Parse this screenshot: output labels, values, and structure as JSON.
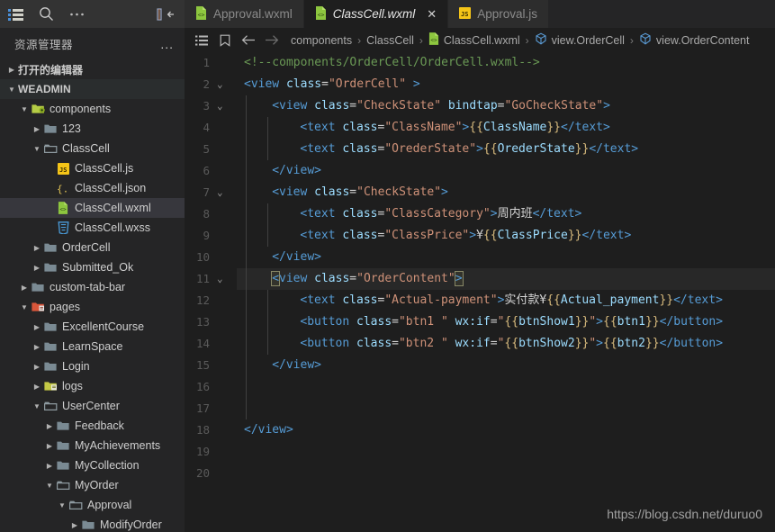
{
  "activity_bar": {
    "icons": [
      {
        "name": "explorer-list-icon",
        "label": "list"
      },
      {
        "name": "search-icon",
        "label": "search"
      },
      {
        "name": "more-actions-icon",
        "label": "..."
      }
    ],
    "collapse_label": "collapse-sidebar"
  },
  "sidebar": {
    "title": "资源管理器",
    "more_label": "...",
    "sections": [
      {
        "label": "打开的编辑器",
        "expanded": false
      },
      {
        "label": "WEADMIN",
        "expanded": true
      }
    ],
    "tree": [
      {
        "label": "components",
        "depth": 1,
        "icon": "folder-components",
        "open": true,
        "selected": false
      },
      {
        "label": "123",
        "depth": 2,
        "icon": "folder",
        "open": false,
        "selected": false
      },
      {
        "label": "ClassCell",
        "depth": 2,
        "icon": "folder-open",
        "open": true,
        "selected": false
      },
      {
        "label": "ClassCell.js",
        "depth": 3,
        "icon": "file-js",
        "open": null,
        "selected": false
      },
      {
        "label": "ClassCell.json",
        "depth": 3,
        "icon": "file-json",
        "open": null,
        "selected": false
      },
      {
        "label": "ClassCell.wxml",
        "depth": 3,
        "icon": "file-wxml",
        "open": null,
        "selected": true
      },
      {
        "label": "ClassCell.wxss",
        "depth": 3,
        "icon": "file-wxss",
        "open": null,
        "selected": false
      },
      {
        "label": "OrderCell",
        "depth": 2,
        "icon": "folder",
        "open": false,
        "selected": false
      },
      {
        "label": "Submitted_Ok",
        "depth": 2,
        "icon": "folder",
        "open": false,
        "selected": false
      },
      {
        "label": "custom-tab-bar",
        "depth": 1,
        "icon": "folder",
        "open": false,
        "selected": false
      },
      {
        "label": "pages",
        "depth": 1,
        "icon": "folder-pages",
        "open": true,
        "selected": false
      },
      {
        "label": "ExcellentCourse",
        "depth": 2,
        "icon": "folder",
        "open": false,
        "selected": false
      },
      {
        "label": "LearnSpace",
        "depth": 2,
        "icon": "folder",
        "open": false,
        "selected": false
      },
      {
        "label": "Login",
        "depth": 2,
        "icon": "folder",
        "open": false,
        "selected": false
      },
      {
        "label": "logs",
        "depth": 2,
        "icon": "folder-logs",
        "open": false,
        "selected": false
      },
      {
        "label": "UserCenter",
        "depth": 2,
        "icon": "folder-open",
        "open": true,
        "selected": false
      },
      {
        "label": "Feedback",
        "depth": 3,
        "icon": "folder",
        "open": false,
        "selected": false
      },
      {
        "label": "MyAchievements",
        "depth": 3,
        "icon": "folder",
        "open": false,
        "selected": false
      },
      {
        "label": "MyCollection",
        "depth": 3,
        "icon": "folder",
        "open": false,
        "selected": false
      },
      {
        "label": "MyOrder",
        "depth": 3,
        "icon": "folder-open",
        "open": true,
        "selected": false
      },
      {
        "label": "Approval",
        "depth": 4,
        "icon": "folder-open",
        "open": true,
        "selected": false
      },
      {
        "label": "ModifyOrder",
        "depth": 5,
        "icon": "folder",
        "open": false,
        "selected": false
      }
    ]
  },
  "tabs": [
    {
      "label": "Approval.wxml",
      "icon": "file-wxml",
      "active": false,
      "closable": false
    },
    {
      "label": "ClassCell.wxml",
      "icon": "file-wxml",
      "active": true,
      "closable": true,
      "close_label": "✕"
    },
    {
      "label": "Approval.js",
      "icon": "file-js",
      "active": false,
      "closable": false
    }
  ],
  "breadcrumb": {
    "icons": [
      "outline-list-icon",
      "bookmark-icon",
      "arrow-left-icon",
      "arrow-right-icon"
    ],
    "items": [
      {
        "text": "components",
        "icon": null
      },
      {
        "text": "ClassCell",
        "icon": null
      },
      {
        "text": "ClassCell.wxml",
        "icon": "file-wxml"
      },
      {
        "text": "view.OrderCell",
        "icon": "symbol-cube"
      },
      {
        "text": "view.OrderContent",
        "icon": "symbol-cube"
      }
    ],
    "separator": "›"
  },
  "editor": {
    "language": "wxml",
    "current_line": 11,
    "total_lines": 20,
    "line_numbers": [
      1,
      2,
      3,
      4,
      5,
      6,
      7,
      8,
      9,
      10,
      11,
      12,
      13,
      14,
      15,
      16,
      17,
      18,
      19,
      20
    ],
    "fold_lines": [
      2,
      3,
      7,
      11
    ],
    "lines": [
      {
        "n": 1,
        "indent": 0,
        "tokens": [
          {
            "t": "<!--components/OrderCell/OrderCell.wxml-->",
            "c": "t-com"
          }
        ]
      },
      {
        "n": 2,
        "indent": 0,
        "tokens": [
          {
            "t": "<",
            "c": "t-tag"
          },
          {
            "t": "view",
            "c": "t-tag"
          },
          {
            "t": " ",
            "c": "t-txt"
          },
          {
            "t": "class",
            "c": "t-attr"
          },
          {
            "t": "=",
            "c": "t-txt"
          },
          {
            "t": "\"OrderCell\"",
            "c": "t-str"
          },
          {
            "t": " >",
            "c": "t-tag"
          }
        ]
      },
      {
        "n": 3,
        "indent": 1,
        "tokens": [
          {
            "t": "<",
            "c": "t-tag"
          },
          {
            "t": "view",
            "c": "t-tag"
          },
          {
            "t": " ",
            "c": "t-txt"
          },
          {
            "t": "class",
            "c": "t-attr"
          },
          {
            "t": "=",
            "c": "t-txt"
          },
          {
            "t": "\"CheckState\"",
            "c": "t-str"
          },
          {
            "t": " ",
            "c": "t-txt"
          },
          {
            "t": "bindtap",
            "c": "t-attr"
          },
          {
            "t": "=",
            "c": "t-txt"
          },
          {
            "t": "\"GoCheckState\"",
            "c": "t-str"
          },
          {
            "t": ">",
            "c": "t-tag"
          }
        ]
      },
      {
        "n": 4,
        "indent": 2,
        "tokens": [
          {
            "t": "<",
            "c": "t-tag"
          },
          {
            "t": "text",
            "c": "t-tag"
          },
          {
            "t": " ",
            "c": "t-txt"
          },
          {
            "t": "class",
            "c": "t-attr"
          },
          {
            "t": "=",
            "c": "t-txt"
          },
          {
            "t": "\"ClassName\"",
            "c": "t-str"
          },
          {
            "t": ">",
            "c": "t-tag"
          },
          {
            "t": "{{",
            "c": "t-brc"
          },
          {
            "t": "ClassName",
            "c": "t-attr"
          },
          {
            "t": "}}",
            "c": "t-brc"
          },
          {
            "t": "</",
            "c": "t-tag"
          },
          {
            "t": "text",
            "c": "t-tag"
          },
          {
            "t": ">",
            "c": "t-tag"
          }
        ]
      },
      {
        "n": 5,
        "indent": 2,
        "tokens": [
          {
            "t": "<",
            "c": "t-tag"
          },
          {
            "t": "text",
            "c": "t-tag"
          },
          {
            "t": " ",
            "c": "t-txt"
          },
          {
            "t": "class",
            "c": "t-attr"
          },
          {
            "t": "=",
            "c": "t-txt"
          },
          {
            "t": "\"OrederState\"",
            "c": "t-str"
          },
          {
            "t": ">",
            "c": "t-tag"
          },
          {
            "t": "{{",
            "c": "t-brc"
          },
          {
            "t": "OrederState",
            "c": "t-attr"
          },
          {
            "t": "}}",
            "c": "t-brc"
          },
          {
            "t": "</",
            "c": "t-tag"
          },
          {
            "t": "text",
            "c": "t-tag"
          },
          {
            "t": ">",
            "c": "t-tag"
          }
        ]
      },
      {
        "n": 6,
        "indent": 1,
        "tokens": [
          {
            "t": "</",
            "c": "t-tag"
          },
          {
            "t": "view",
            "c": "t-tag"
          },
          {
            "t": ">",
            "c": "t-tag"
          }
        ]
      },
      {
        "n": 7,
        "indent": 1,
        "tokens": [
          {
            "t": "<",
            "c": "t-tag"
          },
          {
            "t": "view",
            "c": "t-tag"
          },
          {
            "t": " ",
            "c": "t-txt"
          },
          {
            "t": "class",
            "c": "t-attr"
          },
          {
            "t": "=",
            "c": "t-txt"
          },
          {
            "t": "\"CheckState\"",
            "c": "t-str"
          },
          {
            "t": ">",
            "c": "t-tag"
          }
        ]
      },
      {
        "n": 8,
        "indent": 2,
        "tokens": [
          {
            "t": "<",
            "c": "t-tag"
          },
          {
            "t": "text",
            "c": "t-tag"
          },
          {
            "t": " ",
            "c": "t-txt"
          },
          {
            "t": "class",
            "c": "t-attr"
          },
          {
            "t": "=",
            "c": "t-txt"
          },
          {
            "t": "\"ClassCategory\"",
            "c": "t-str"
          },
          {
            "t": ">",
            "c": "t-tag"
          },
          {
            "t": "周内班",
            "c": "t-txt"
          },
          {
            "t": "</",
            "c": "t-tag"
          },
          {
            "t": "text",
            "c": "t-tag"
          },
          {
            "t": ">",
            "c": "t-tag"
          }
        ]
      },
      {
        "n": 9,
        "indent": 2,
        "tokens": [
          {
            "t": "<",
            "c": "t-tag"
          },
          {
            "t": "text",
            "c": "t-tag"
          },
          {
            "t": " ",
            "c": "t-txt"
          },
          {
            "t": "class",
            "c": "t-attr"
          },
          {
            "t": "=",
            "c": "t-txt"
          },
          {
            "t": "\"ClassPrice\"",
            "c": "t-str"
          },
          {
            "t": ">",
            "c": "t-tag"
          },
          {
            "t": "¥",
            "c": "t-txt"
          },
          {
            "t": "{{",
            "c": "t-brc"
          },
          {
            "t": "ClassPrice",
            "c": "t-attr"
          },
          {
            "t": "}}",
            "c": "t-brc"
          },
          {
            "t": "</",
            "c": "t-tag"
          },
          {
            "t": "text",
            "c": "t-tag"
          },
          {
            "t": ">",
            "c": "t-tag"
          }
        ]
      },
      {
        "n": 10,
        "indent": 1,
        "tokens": [
          {
            "t": "</",
            "c": "t-tag"
          },
          {
            "t": "view",
            "c": "t-tag"
          },
          {
            "t": ">",
            "c": "t-tag"
          }
        ]
      },
      {
        "n": 11,
        "indent": 1,
        "tokens": [
          {
            "t": "<",
            "c": "t-tag brk"
          },
          {
            "t": "view",
            "c": "t-tag"
          },
          {
            "t": " ",
            "c": "t-txt"
          },
          {
            "t": "class",
            "c": "t-attr"
          },
          {
            "t": "=",
            "c": "t-txt"
          },
          {
            "t": "\"OrderContent\"",
            "c": "t-str"
          },
          {
            "t": ">",
            "c": "t-tag brk"
          }
        ]
      },
      {
        "n": 12,
        "indent": 2,
        "tokens": [
          {
            "t": "<",
            "c": "t-tag"
          },
          {
            "t": "text",
            "c": "t-tag"
          },
          {
            "t": " ",
            "c": "t-txt"
          },
          {
            "t": "class",
            "c": "t-attr"
          },
          {
            "t": "=",
            "c": "t-txt"
          },
          {
            "t": "\"Actual-payment\"",
            "c": "t-str"
          },
          {
            "t": ">",
            "c": "t-tag"
          },
          {
            "t": "实付款¥",
            "c": "t-txt"
          },
          {
            "t": "{{",
            "c": "t-brc"
          },
          {
            "t": "Actual_payment",
            "c": "t-attr"
          },
          {
            "t": "}}",
            "c": "t-brc"
          },
          {
            "t": "</",
            "c": "t-tag"
          },
          {
            "t": "text",
            "c": "t-tag"
          },
          {
            "t": ">",
            "c": "t-tag"
          }
        ]
      },
      {
        "n": 13,
        "indent": 2,
        "tokens": [
          {
            "t": "<",
            "c": "t-tag"
          },
          {
            "t": "button",
            "c": "t-tag"
          },
          {
            "t": " ",
            "c": "t-txt"
          },
          {
            "t": "class",
            "c": "t-attr"
          },
          {
            "t": "=",
            "c": "t-txt"
          },
          {
            "t": "\"btn1 \"",
            "c": "t-str"
          },
          {
            "t": " ",
            "c": "t-txt"
          },
          {
            "t": "wx:if",
            "c": "t-attr"
          },
          {
            "t": "=",
            "c": "t-txt"
          },
          {
            "t": "\"",
            "c": "t-str"
          },
          {
            "t": "{{",
            "c": "t-brc"
          },
          {
            "t": "btnShow1",
            "c": "t-attr"
          },
          {
            "t": "}}",
            "c": "t-brc"
          },
          {
            "t": "\"",
            "c": "t-str"
          },
          {
            "t": ">",
            "c": "t-tag"
          },
          {
            "t": "{{",
            "c": "t-brc"
          },
          {
            "t": "btn1",
            "c": "t-attr"
          },
          {
            "t": "}}",
            "c": "t-brc"
          },
          {
            "t": "</",
            "c": "t-tag"
          },
          {
            "t": "button",
            "c": "t-tag"
          },
          {
            "t": ">",
            "c": "t-tag"
          }
        ]
      },
      {
        "n": 14,
        "indent": 2,
        "tokens": [
          {
            "t": "<",
            "c": "t-tag"
          },
          {
            "t": "button",
            "c": "t-tag"
          },
          {
            "t": " ",
            "c": "t-txt"
          },
          {
            "t": "class",
            "c": "t-attr"
          },
          {
            "t": "=",
            "c": "t-txt"
          },
          {
            "t": "\"btn2 \"",
            "c": "t-str"
          },
          {
            "t": " ",
            "c": "t-txt"
          },
          {
            "t": "wx:if",
            "c": "t-attr"
          },
          {
            "t": "=",
            "c": "t-txt"
          },
          {
            "t": "\"",
            "c": "t-str"
          },
          {
            "t": "{{",
            "c": "t-brc"
          },
          {
            "t": "btnShow2",
            "c": "t-attr"
          },
          {
            "t": "}}",
            "c": "t-brc"
          },
          {
            "t": "\"",
            "c": "t-str"
          },
          {
            "t": ">",
            "c": "t-tag"
          },
          {
            "t": "{{",
            "c": "t-brc"
          },
          {
            "t": "btn2",
            "c": "t-attr"
          },
          {
            "t": "}}",
            "c": "t-brc"
          },
          {
            "t": "</",
            "c": "t-tag"
          },
          {
            "t": "button",
            "c": "t-tag"
          },
          {
            "t": ">",
            "c": "t-tag"
          }
        ]
      },
      {
        "n": 15,
        "indent": 1,
        "tokens": [
          {
            "t": "</",
            "c": "t-tag"
          },
          {
            "t": "view",
            "c": "t-tag"
          },
          {
            "t": ">",
            "c": "t-tag"
          }
        ]
      },
      {
        "n": 16,
        "indent": 0,
        "tokens": []
      },
      {
        "n": 17,
        "indent": 0,
        "tokens": []
      },
      {
        "n": 18,
        "indent": 0,
        "tokens": [
          {
            "t": "</",
            "c": "t-tag"
          },
          {
            "t": "view",
            "c": "t-tag"
          },
          {
            "t": ">",
            "c": "t-tag"
          }
        ]
      },
      {
        "n": 19,
        "indent": 0,
        "tokens": []
      },
      {
        "n": 20,
        "indent": 0,
        "tokens": []
      }
    ]
  },
  "watermark": "https://blog.csdn.net/duruo0",
  "colors": {
    "editor_bg": "#1e1e1e",
    "sidebar_bg": "#252526",
    "titlebar_bg": "#333333",
    "tab_inactive_bg": "#2d2d2d",
    "selection_bg": "#37373d",
    "comment": "#6a9955",
    "tag": "#569cd6",
    "attribute": "#9cdcfe",
    "string": "#ce9178",
    "braces": "#d7ba7d",
    "text": "#d4d4d4"
  }
}
